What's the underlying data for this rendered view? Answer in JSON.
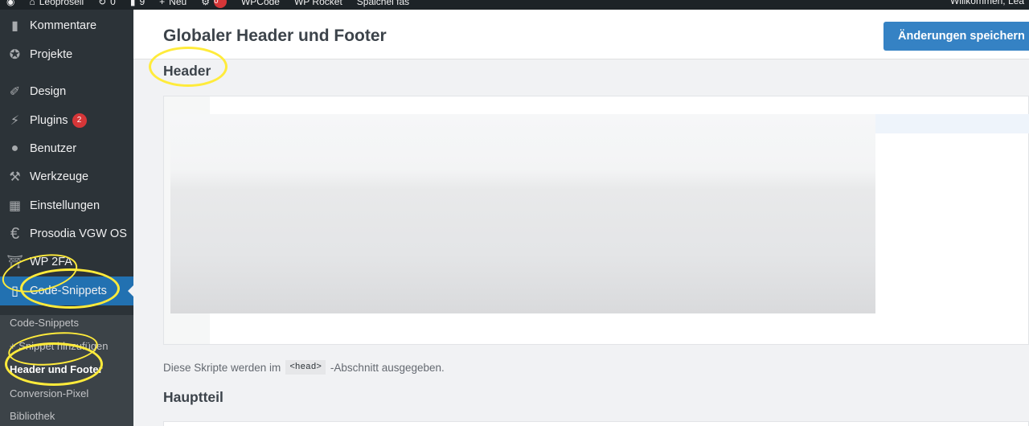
{
  "adminbar": {
    "site_name": "Leoprosell",
    "comments_count": "0",
    "updates_count": "9",
    "new_label": "Neu",
    "notifications_count": "0",
    "item_wpcode": "WPCode",
    "item_wpvorschau": "WP Rocket",
    "item_spaichelfas": "Spaichel fas",
    "greeting": "Willkommen, Lea"
  },
  "sidebar": {
    "items": [
      {
        "label": "Kommentare",
        "icon": "comment-icon"
      },
      {
        "label": "Projekte",
        "icon": "pin-icon"
      },
      {
        "label": "Design",
        "icon": "brush-icon"
      },
      {
        "label": "Plugins",
        "icon": "plug-icon",
        "badge": "2"
      },
      {
        "label": "Benutzer",
        "icon": "user-icon"
      },
      {
        "label": "Werkzeuge",
        "icon": "wrench-icon"
      },
      {
        "label": "Einstellungen",
        "icon": "settings-icon"
      },
      {
        "label": "Prosodia VGW OS",
        "icon": "euro-icon"
      },
      {
        "label": "WP 2FA",
        "icon": "shield-lock-icon"
      },
      {
        "label": "Code-Snippets",
        "icon": "code-icon"
      }
    ],
    "submenu": [
      {
        "label": "Code-Snippets"
      },
      {
        "label": "+ Snippet hinzufügen"
      },
      {
        "label": "Header und Footer"
      },
      {
        "label": "Conversion-Pixel"
      },
      {
        "label": "Bibliothek"
      }
    ]
  },
  "main": {
    "page_title": "Globaler Header und Footer",
    "save_button": "Änderungen speichern",
    "header_section": "Header",
    "desc_before": "Diese Skripte werden im",
    "desc_code": "<head>",
    "desc_after": "-Abschnitt ausgegeben.",
    "body_section": "Hauptteil"
  },
  "colors": {
    "accent": "#2271b1",
    "button": "#3582c4",
    "sidebar": "#2c3338",
    "annotation": "#ffeb3b"
  }
}
